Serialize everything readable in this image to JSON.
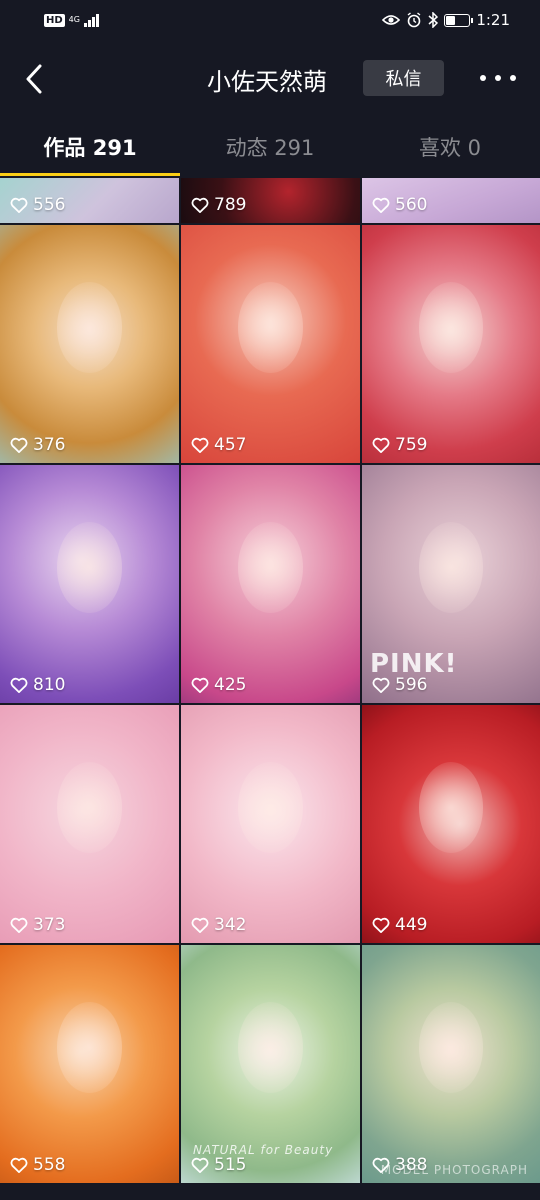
{
  "status_bar": {
    "hd": "HD",
    "network": "4G",
    "time": "1:21"
  },
  "header": {
    "title": "小佐天然萌",
    "private_message_label": "私信"
  },
  "tabs": [
    {
      "label": "作品 291",
      "active": true
    },
    {
      "label": "动态 291",
      "active": false
    },
    {
      "label": "喜欢 0",
      "active": false
    }
  ],
  "colors": {
    "background": "#161823",
    "active_tab_underline": "#face15",
    "inactive_tab_text": "#8b8c91",
    "pm_button_bg": "#393b44"
  },
  "videos": [
    {
      "likes": "556",
      "art": "teal-purple"
    },
    {
      "likes": "789",
      "art": "dark-red"
    },
    {
      "likes": "560",
      "art": "lilac"
    },
    {
      "likes": "376",
      "art": "autumn-gold"
    },
    {
      "likes": "457",
      "art": "coral-red"
    },
    {
      "likes": "759",
      "art": "rose-hat"
    },
    {
      "likes": "810",
      "art": "violet"
    },
    {
      "likes": "425",
      "art": "pink-magenta"
    },
    {
      "likes": "596",
      "art": "mauve",
      "overlay": "PINK!"
    },
    {
      "likes": "373",
      "art": "pink-feather"
    },
    {
      "likes": "342",
      "art": "pale-pink"
    },
    {
      "likes": "449",
      "art": "crimson"
    },
    {
      "likes": "558",
      "art": "orange"
    },
    {
      "likes": "515",
      "art": "mint-green",
      "overlay": "NATURAL for Beauty"
    },
    {
      "likes": "388",
      "art": "sage",
      "overlay": "MODEL PHOTOGRAPH"
    }
  ]
}
